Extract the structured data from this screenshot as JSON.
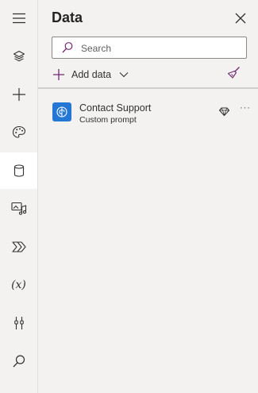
{
  "rail": {
    "items": [
      {
        "icon": "hamburger-menu-icon"
      },
      {
        "icon": "layers-icon"
      },
      {
        "icon": "plus-icon"
      },
      {
        "icon": "palette-icon"
      },
      {
        "icon": "database-icon",
        "active": true
      },
      {
        "icon": "media-icon"
      },
      {
        "icon": "power-automate-icon"
      },
      {
        "icon": "variables-icon"
      },
      {
        "icon": "tools-icon"
      },
      {
        "icon": "search-icon"
      }
    ],
    "variables_glyph": "(x)"
  },
  "panel": {
    "title": "Data",
    "search_placeholder": "Search",
    "add_data_label": "Add data",
    "items": [
      {
        "title": "Contact Support",
        "subtitle": "Custom prompt",
        "more": "···"
      }
    ]
  },
  "colors": {
    "accent": "#742774",
    "tile": "#2478d4",
    "background": "#f3f2f1"
  }
}
